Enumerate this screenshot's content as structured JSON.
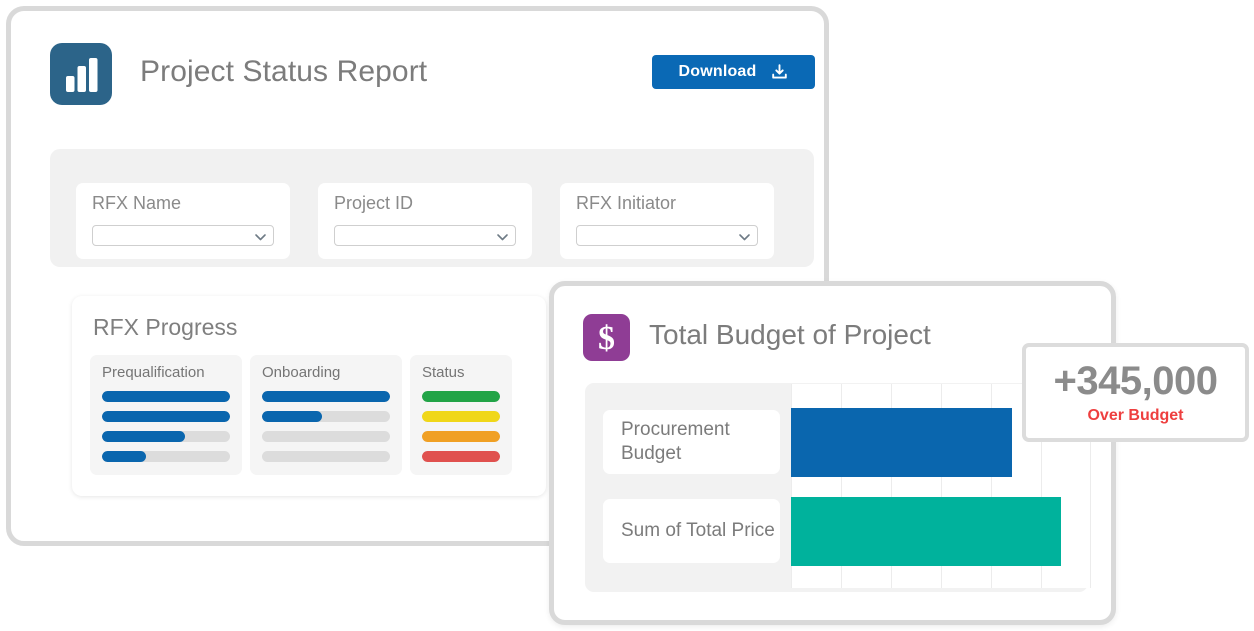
{
  "report": {
    "title": "Project Status Report",
    "icon": "bar-chart-icon",
    "download": {
      "label": "Download",
      "icon": "download-icon",
      "color": "#0a69b5"
    },
    "filters": [
      {
        "label": "RFX Name",
        "value": "",
        "placeholder": "",
        "icon": "chevron-down-icon"
      },
      {
        "label": "Project ID",
        "value": "",
        "placeholder": "",
        "icon": "chevron-down-icon"
      },
      {
        "label": "RFX Initiator",
        "value": "",
        "placeholder": "",
        "icon": "chevron-down-icon"
      }
    ],
    "progress": {
      "title": "RFX Progress",
      "columns": [
        {
          "label": "Prequalification",
          "bars": [
            {
              "percent": 100,
              "color": "#0a66ae"
            },
            {
              "percent": 100,
              "color": "#0a66ae"
            },
            {
              "percent": 65,
              "color": "#0a66ae"
            },
            {
              "percent": 34,
              "color": "#0a66ae"
            }
          ]
        },
        {
          "label": "Onboarding",
          "bars": [
            {
              "percent": 100,
              "color": "#0a66ae"
            },
            {
              "percent": 47,
              "color": "#0a66ae"
            },
            {
              "percent": 0,
              "color": "#0a66ae"
            },
            {
              "percent": 0,
              "color": "#0a66ae"
            }
          ]
        },
        {
          "label": "Status",
          "bars": [
            {
              "percent": 100,
              "color": "#22a447"
            },
            {
              "percent": 100,
              "color": "#f0d719"
            },
            {
              "percent": 100,
              "color": "#f0a024"
            },
            {
              "percent": 100,
              "color": "#e0514f"
            }
          ]
        }
      ]
    }
  },
  "budget": {
    "title": "Total Budget of Project",
    "icon": "dollar-icon",
    "icon_color": "#8f3d95",
    "callout": {
      "value": "+345,000",
      "caption": "Over Budget",
      "caption_color": "#ee3f3f"
    }
  },
  "chart_data": {
    "type": "bar",
    "orientation": "horizontal",
    "title": "Total Budget of Project",
    "categories": [
      "Procurement Budget",
      "Sum of Total Price"
    ],
    "values": [
      1120000,
      1465000
    ],
    "colors": [
      "#0a66ae",
      "#00b29c"
    ],
    "bar_percent": [
      73.5,
      90.0
    ],
    "xlabel": "",
    "ylabel": "",
    "xlim": [
      0,
      1500000
    ],
    "gridlines": 6,
    "grid": true,
    "legend": false,
    "annotations": [
      "+345,000 Over Budget"
    ]
  }
}
